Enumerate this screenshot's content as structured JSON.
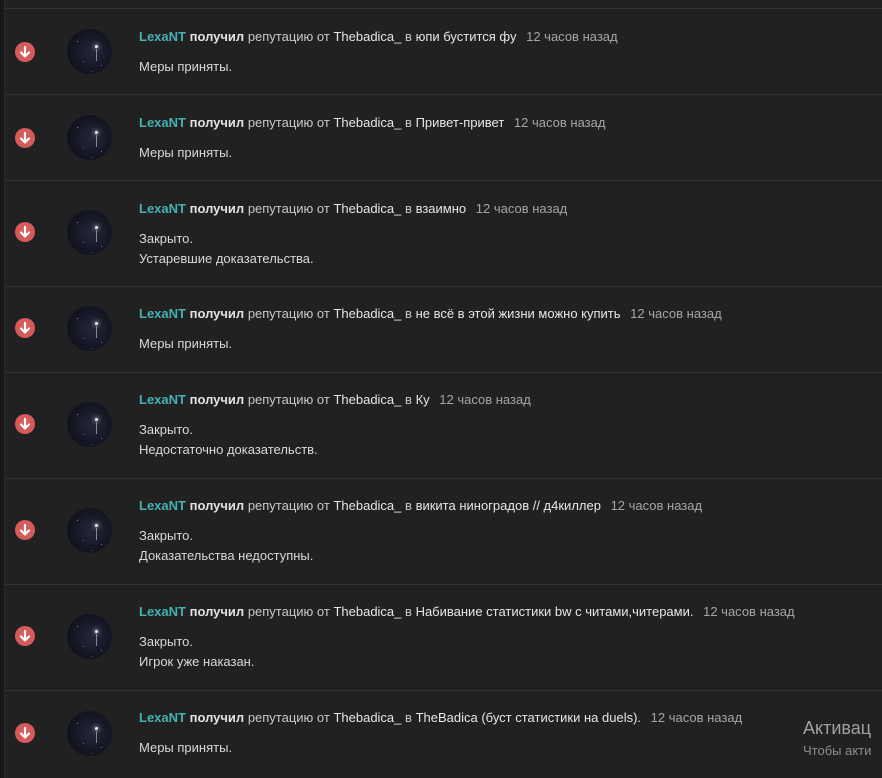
{
  "feed": {
    "items": [
      {
        "user": "LexaNT",
        "verb": "получил",
        "action": "репутацию от",
        "from": "Thebadica_",
        "in_word": "в",
        "thread": "юпи бустится фу",
        "time": "12 часов назад",
        "lines": [
          "Меры приняты."
        ]
      },
      {
        "user": "LexaNT",
        "verb": "получил",
        "action": "репутацию от",
        "from": "Thebadica_",
        "in_word": "в",
        "thread": "Привет-привет",
        "time": "12 часов назад",
        "lines": [
          "Меры приняты."
        ]
      },
      {
        "user": "LexaNT",
        "verb": "получил",
        "action": "репутацию от",
        "from": "Thebadica_",
        "in_word": "в",
        "thread": "взаимно",
        "time": "12 часов назад",
        "lines": [
          "Закрыто.",
          "Устаревшие доказательства."
        ]
      },
      {
        "user": "LexaNT",
        "verb": "получил",
        "action": "репутацию от",
        "from": "Thebadica_",
        "in_word": "в",
        "thread": "не всё в этой жизни можно купить",
        "time": "12 часов назад",
        "lines": [
          "Меры приняты."
        ]
      },
      {
        "user": "LexaNT",
        "verb": "получил",
        "action": "репутацию от",
        "from": "Thebadica_",
        "in_word": "в",
        "thread": "Ку",
        "time": "12 часов назад",
        "lines": [
          "Закрыто.",
          "Недостаточно доказательств."
        ]
      },
      {
        "user": "LexaNT",
        "verb": "получил",
        "action": "репутацию от",
        "from": "Thebadica_",
        "in_word": "в",
        "thread": "викита ниноградов // д4киллер",
        "time": "12 часов назад",
        "lines": [
          "Закрыто.",
          "Доказательства недоступны."
        ]
      },
      {
        "user": "LexaNT",
        "verb": "получил",
        "action": "репутацию от",
        "from": "Thebadica_",
        "in_word": "в",
        "thread": "Набивание статистики bw с читами,читерами.",
        "time": "12 часов назад",
        "lines": [
          "Закрыто.",
          "Игрок уже наказан."
        ]
      },
      {
        "user": "LexaNT",
        "verb": "получил",
        "action": "репутацию от",
        "from": "Thebadica_",
        "in_word": "в",
        "thread": "TheBadica (буст статистики на duels).",
        "time": "12 часов назад",
        "lines": [
          "Меры приняты."
        ]
      }
    ]
  },
  "watermark": {
    "title": "Активац",
    "subtitle": "Чтобы акти"
  },
  "colors": {
    "background": "#212121",
    "username": "#44b2b2",
    "negative_badge": "#d55a5a",
    "separator": "#333333"
  },
  "icons": {
    "reputation_negative": "arrow-down-circle-icon",
    "avatar": "user-avatar"
  }
}
